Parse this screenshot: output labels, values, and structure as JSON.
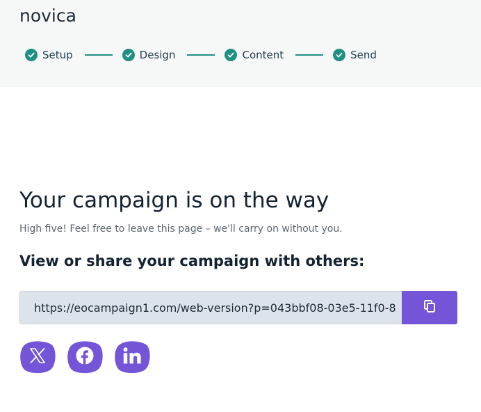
{
  "header": {
    "app_title": "novica",
    "steps": [
      {
        "label": "Setup",
        "status": "complete"
      },
      {
        "label": "Design",
        "status": "complete"
      },
      {
        "label": "Content",
        "status": "complete"
      },
      {
        "label": "Send",
        "status": "complete"
      }
    ]
  },
  "main": {
    "title": "Your campaign is on the way",
    "subtitle": "High five! Feel free to leave this page – we'll carry on without you.",
    "share_heading": "View or share your campaign with others:",
    "campaign_url": "https://eocampaign1.com/web-version?p=043bbf08-03e5-11f0-8",
    "copy_icon": "copy-icon"
  },
  "social": [
    {
      "icon": "x-icon",
      "network": "X"
    },
    {
      "icon": "facebook-icon",
      "network": "Facebook"
    },
    {
      "icon": "linkedin-icon",
      "network": "LinkedIn"
    }
  ],
  "colors": {
    "accent": "#7455d8",
    "step_complete": "#1e8f82",
    "header_bg": "#f6f8f7",
    "url_box_bg": "#dde3eb"
  }
}
